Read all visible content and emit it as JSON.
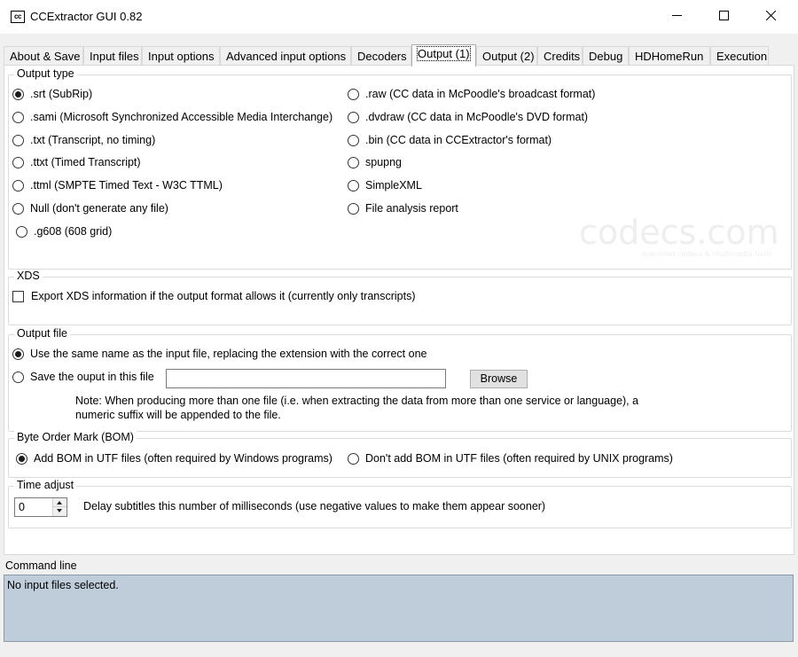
{
  "window": {
    "icon_text": "cc",
    "title": "CCExtractor GUI 0.82"
  },
  "tabs": [
    {
      "label": "About & Save"
    },
    {
      "label": "Input files"
    },
    {
      "label": "Input options"
    },
    {
      "label": "Advanced input options"
    },
    {
      "label": "Decoders"
    },
    {
      "label": "Output (1)",
      "active": true
    },
    {
      "label": "Output (2)"
    },
    {
      "label": "Credits"
    },
    {
      "label": "Debug"
    },
    {
      "label": "HDHomeRun"
    },
    {
      "label": "Execution"
    }
  ],
  "output_type": {
    "title": "Output type",
    "left": [
      {
        "label": ".srt (SubRip)",
        "checked": true
      },
      {
        "label": ".sami (Microsoft Synchronized Accessible Media Interchange)",
        "checked": false
      },
      {
        "label": ".txt (Transcript, no timing)",
        "checked": false
      },
      {
        "label": ".ttxt (Timed Transcript)",
        "checked": false
      },
      {
        "label": ".ttml (SMPTE Timed Text - W3C TTML)",
        "checked": false
      },
      {
        "label": "Null (don't generate any file)",
        "checked": false
      },
      {
        "label": ".g608 (608 grid)",
        "checked": false
      }
    ],
    "right": [
      {
        "label": ".raw (CC data in McPoodle's broadcast format)",
        "checked": false
      },
      {
        "label": ".dvdraw (CC data in McPoodle's DVD format)",
        "checked": false
      },
      {
        "label": ".bin (CC data in CCExtractor's format)",
        "checked": false
      },
      {
        "label": "spupng",
        "checked": false
      },
      {
        "label": "SimpleXML",
        "checked": false
      },
      {
        "label": "File analysis report",
        "checked": false
      }
    ]
  },
  "watermark": {
    "main": "codecs.com",
    "sub": "download codecs & multimedia tools"
  },
  "xds": {
    "title": "XDS",
    "checkbox_label": "Export XDS information if the output format allows it (currently only transcripts)",
    "checked": false
  },
  "output_file": {
    "title": "Output file",
    "same_name_label": "Use the same name as the input file, replacing the extension with the correct one",
    "same_name_checked": true,
    "save_label": "Save the ouput in this file",
    "save_checked": false,
    "path_value": "",
    "browse_label": "Browse",
    "note_line1": "Note: When producing more than one file (i.e. when extracting the data from more than one service or language),  a",
    "note_line2": "numeric suffix will be appended to the file."
  },
  "bom": {
    "title": "Byte Order Mark (BOM)",
    "add_label": "Add BOM in UTF files (often required by Windows programs)",
    "add_checked": true,
    "dont_label": "Don't add BOM in UTF files (often required by UNIX programs)",
    "dont_checked": false
  },
  "time_adjust": {
    "title": "Time adjust",
    "value": "0",
    "label": "Delay subtitles this number of milliseconds (use negative values to make them appear sooner)"
  },
  "command_line": {
    "label": "Command line",
    "text": "No input files selected."
  }
}
